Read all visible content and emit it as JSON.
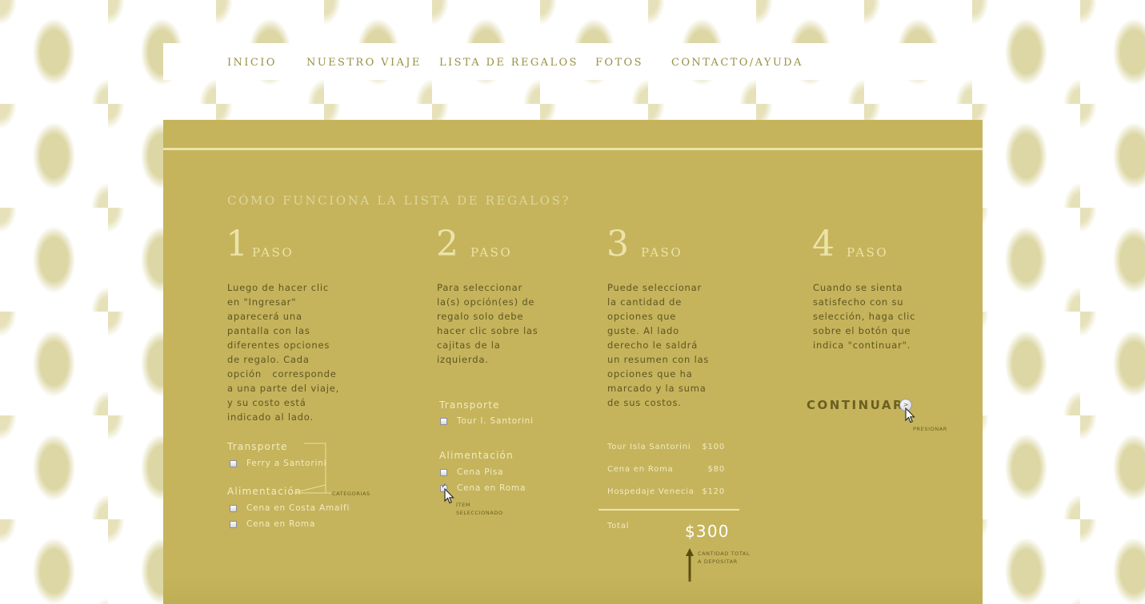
{
  "nav": {
    "items": [
      "INICIO",
      "NUESTRO VIAJE",
      "LISTA DE REGALOS",
      "FOTOS",
      "CONTACTO/AYUDA"
    ]
  },
  "panel": {
    "title": "CÓMO FUNCIONA LA LISTA DE REGALOS?"
  },
  "steps": [
    {
      "number": "1",
      "word": "PASO",
      "desc": [
        "Luego de hacer clic",
        "en \"Ingresar\"",
        "aparecerá una",
        "pantalla con las",
        "diferentes opciones",
        "de regalo. Cada",
        "opción   corresponde",
        "a una parte del viaje,",
        "y su costo está",
        "indicado al lado."
      ],
      "categories": [
        {
          "label": "Transporte",
          "items": [
            "Ferry a Santorini"
          ]
        },
        {
          "label": "Alimentación",
          "items": [
            "Cena en Costa Amalfi",
            "Cena en Roma"
          ]
        }
      ],
      "annotation": "CATEGORIAS"
    },
    {
      "number": "2",
      "word": "PASO",
      "desc": [
        "Para seleccionar",
        "la(s) opción(es) de",
        "regalo solo debe",
        "hacer clic sobre las",
        "cajitas de la",
        "izquierda."
      ],
      "categories": [
        {
          "label": "Transporte",
          "items": [
            "Tour I. Santorini"
          ]
        },
        {
          "label": "Alimentación",
          "items": [
            "Cena Pisa",
            "Cena en Roma"
          ]
        }
      ],
      "annotation": [
        "ÍTEM",
        "SELECCIONADO"
      ]
    },
    {
      "number": "3",
      "word": "PASO",
      "desc": [
        "Puede seleccionar",
        "la cantidad de",
        "opciones que",
        "guste. Al lado",
        "derecho le saldrá",
        "un resumen con las",
        "opciones que ha",
        "marcado y la suma",
        "de sus costos."
      ],
      "summary": [
        {
          "name": "Tour Isla Santorini",
          "price": "$100"
        },
        {
          "name": "Cena en Roma",
          "price": "$80"
        },
        {
          "name": "Hospedaje Venecia",
          "price": "$120"
        }
      ],
      "total_label": "Total",
      "total_amount": "$300",
      "annotation": [
        "CANTIDAD TOTAL",
        "A DEPOSITAR"
      ]
    },
    {
      "number": "4",
      "word": "PASO",
      "desc": [
        "Cuando se sienta",
        "satisfecho con su",
        "selección, haga clic",
        "sobre el botón que",
        "indica \"continuar\"."
      ],
      "button_label": "CONTINUAR",
      "button_icon": ">",
      "annotation": "PRESIONAR"
    }
  ],
  "colors": {
    "panel": "#c5b45c",
    "nav_text": "#9a9045",
    "dark_text": "#5f5520",
    "light_text": "#f2ebc2"
  }
}
